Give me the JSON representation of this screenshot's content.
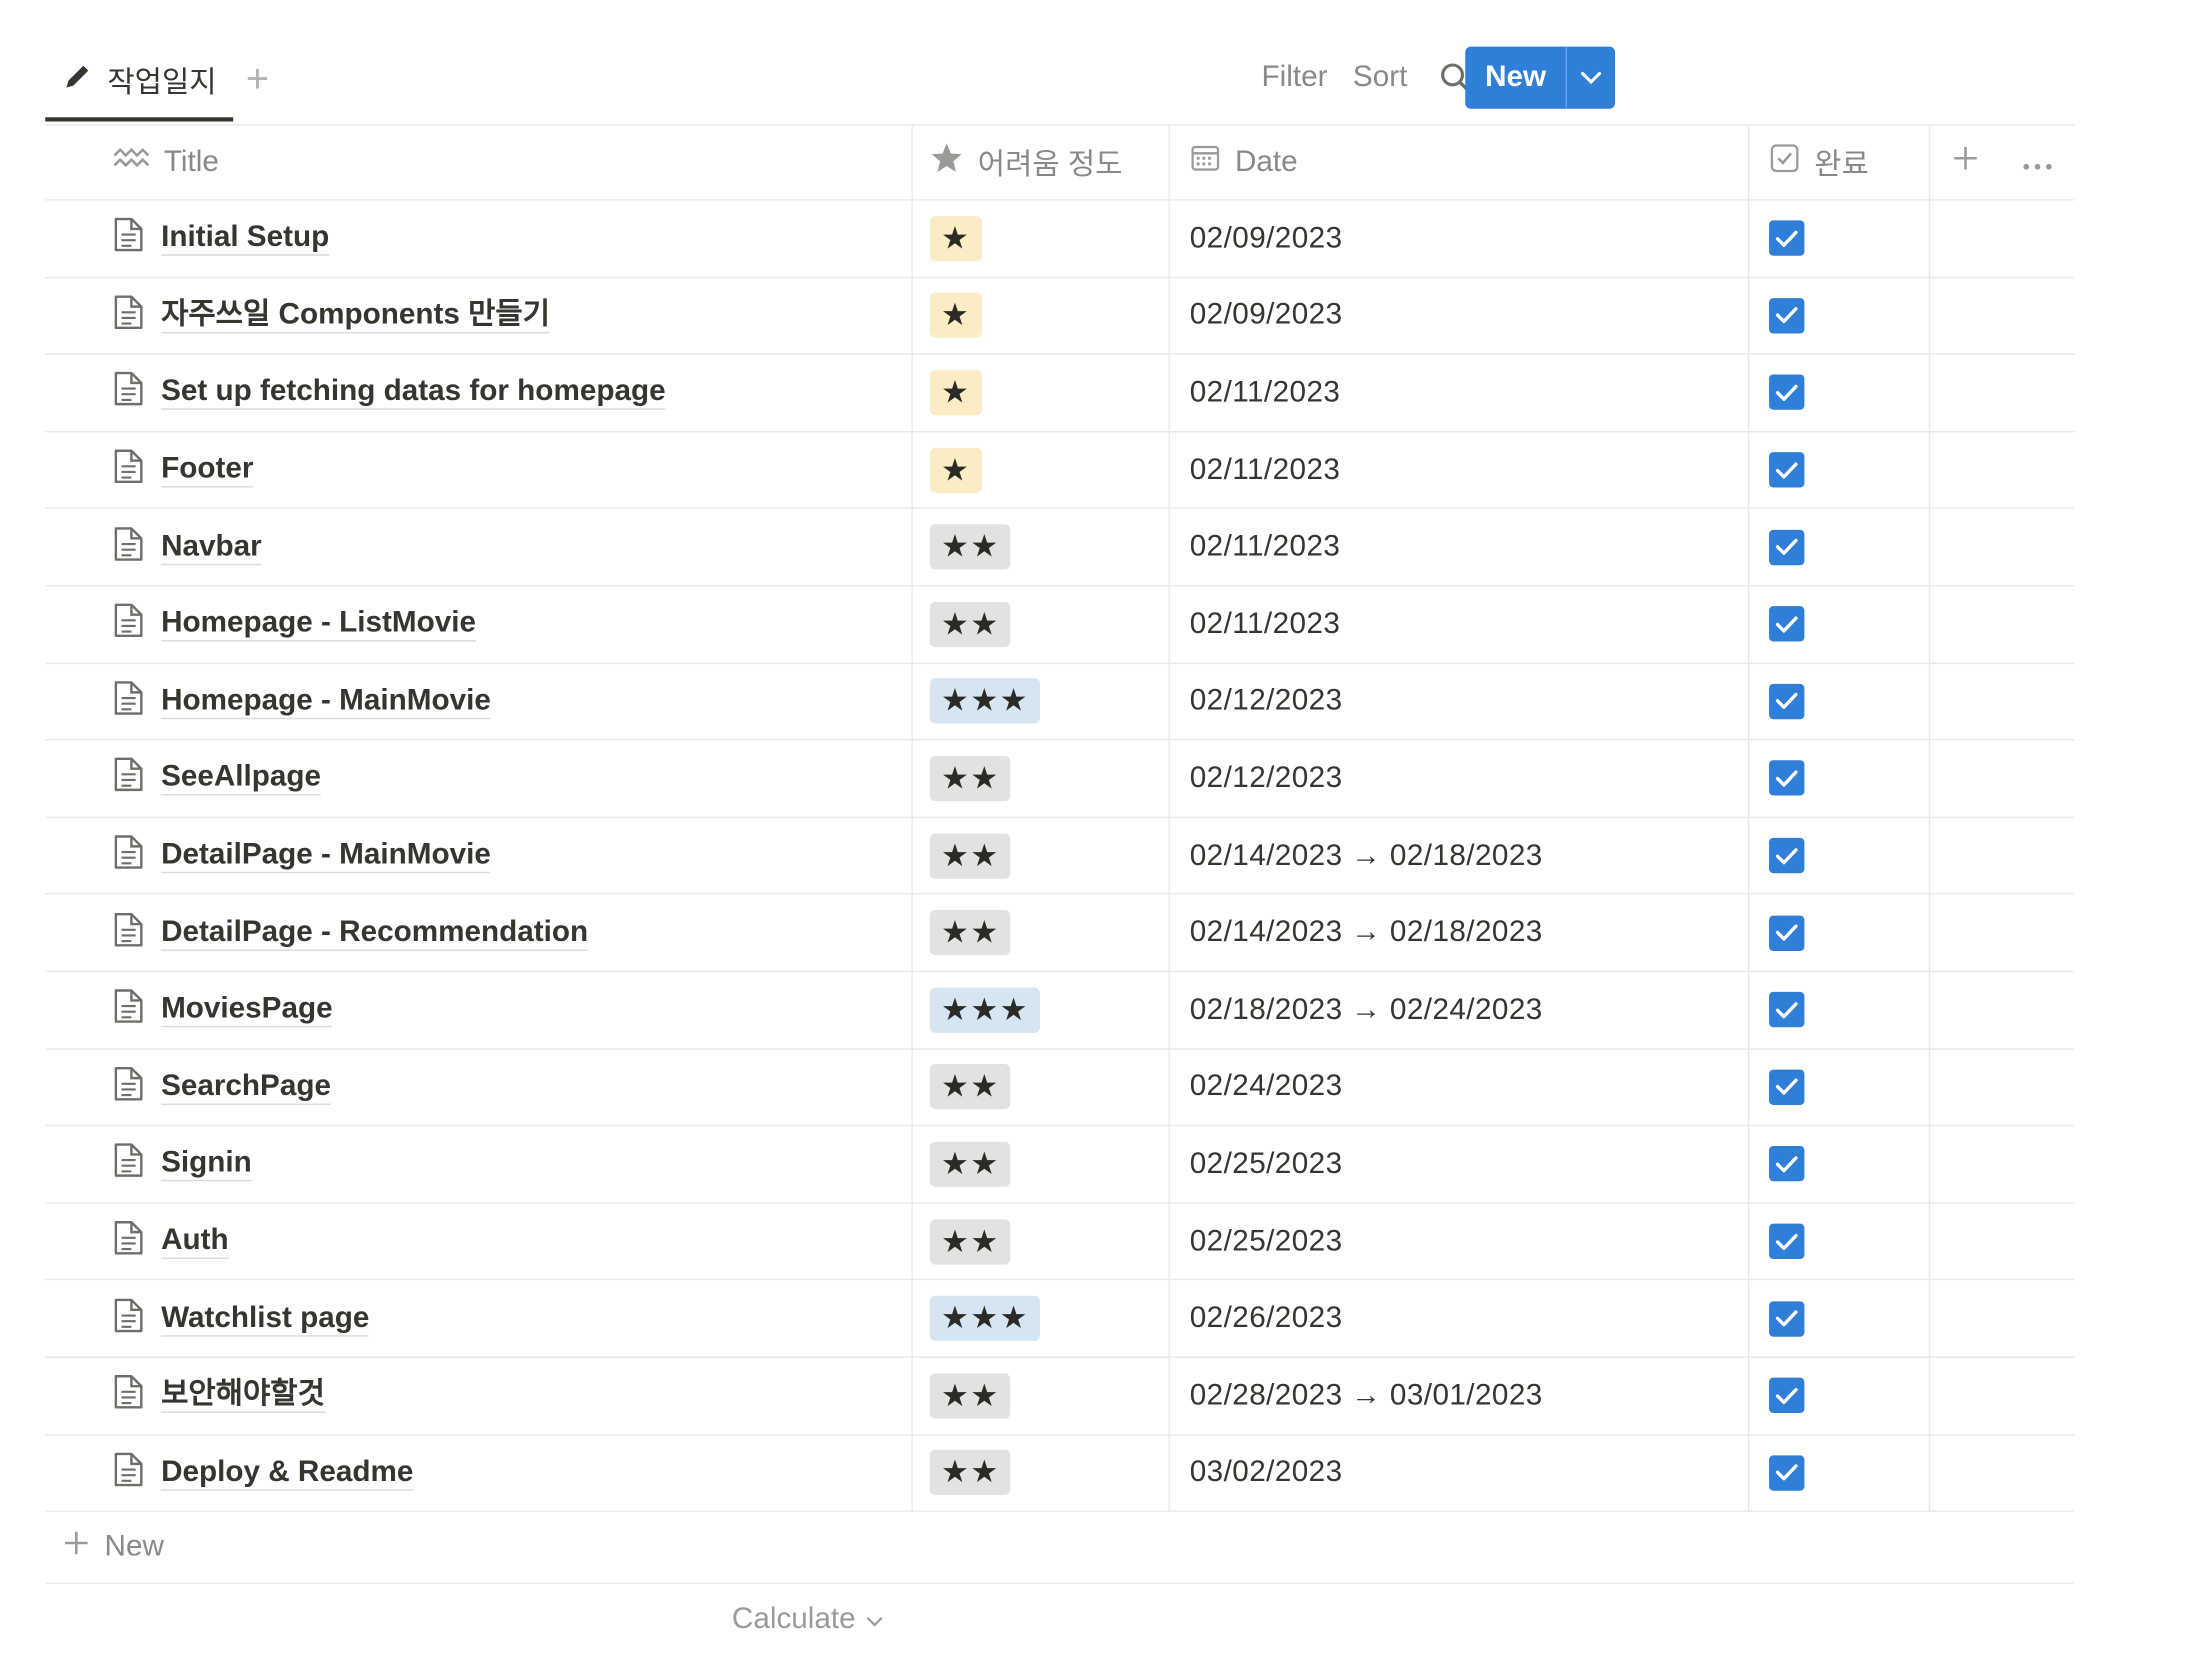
{
  "view": {
    "tab_label": "작업일지"
  },
  "toolbar": {
    "filter_label": "Filter",
    "sort_label": "Sort",
    "new_label": "New"
  },
  "columns": {
    "title": "Title",
    "difficulty": "어려움 정도",
    "date": "Date",
    "done": "완료"
  },
  "rows": [
    {
      "title": "Initial Setup",
      "difficulty": "★",
      "level": 1,
      "date": "02/09/2023",
      "done": true
    },
    {
      "title": "자주쓰일 Components 만들기",
      "difficulty": "★",
      "level": 1,
      "date": "02/09/2023",
      "done": true
    },
    {
      "title": "Set up fetching datas for homepage",
      "difficulty": "★",
      "level": 1,
      "date": "02/11/2023",
      "done": true
    },
    {
      "title": "Footer",
      "difficulty": "★",
      "level": 1,
      "date": "02/11/2023",
      "done": true
    },
    {
      "title": "Navbar",
      "difficulty": "★★",
      "level": 2,
      "date": "02/11/2023",
      "done": true
    },
    {
      "title": "Homepage - ListMovie",
      "difficulty": "★★",
      "level": 2,
      "date": "02/11/2023",
      "done": true
    },
    {
      "title": "Homepage - MainMovie",
      "difficulty": "★★★",
      "level": 3,
      "date": "02/12/2023",
      "done": true
    },
    {
      "title": "SeeAllpage",
      "difficulty": "★★",
      "level": 2,
      "date": "02/12/2023",
      "done": true
    },
    {
      "title": "DetailPage - MainMovie",
      "difficulty": "★★",
      "level": 2,
      "date": "02/14/2023 → 02/18/2023",
      "done": true
    },
    {
      "title": "DetailPage - Recommendation",
      "difficulty": "★★",
      "level": 2,
      "date": "02/14/2023 → 02/18/2023",
      "done": true
    },
    {
      "title": "MoviesPage",
      "difficulty": "★★★",
      "level": 3,
      "date": "02/18/2023 → 02/24/2023",
      "done": true
    },
    {
      "title": "SearchPage",
      "difficulty": "★★",
      "level": 2,
      "date": "02/24/2023",
      "done": true
    },
    {
      "title": "Signin",
      "difficulty": "★★",
      "level": 2,
      "date": "02/25/2023",
      "done": true
    },
    {
      "title": "Auth",
      "difficulty": "★★",
      "level": 2,
      "date": "02/25/2023",
      "done": true
    },
    {
      "title": "Watchlist page",
      "difficulty": "★★★",
      "level": 3,
      "date": "02/26/2023",
      "done": true
    },
    {
      "title": "보안해야할것",
      "difficulty": "★★",
      "level": 2,
      "date": "02/28/2023 → 03/01/2023",
      "done": true
    },
    {
      "title": "Deploy & Readme",
      "difficulty": "★★",
      "level": 2,
      "date": "03/02/2023",
      "done": true
    }
  ],
  "footer": {
    "new_row_label": "New",
    "calculate_label": "Calculate"
  },
  "colors": {
    "accent": "#2f7ed8",
    "level1": "#fbecc6",
    "level2": "#e3e2e0",
    "level3": "#d5e5f1"
  }
}
